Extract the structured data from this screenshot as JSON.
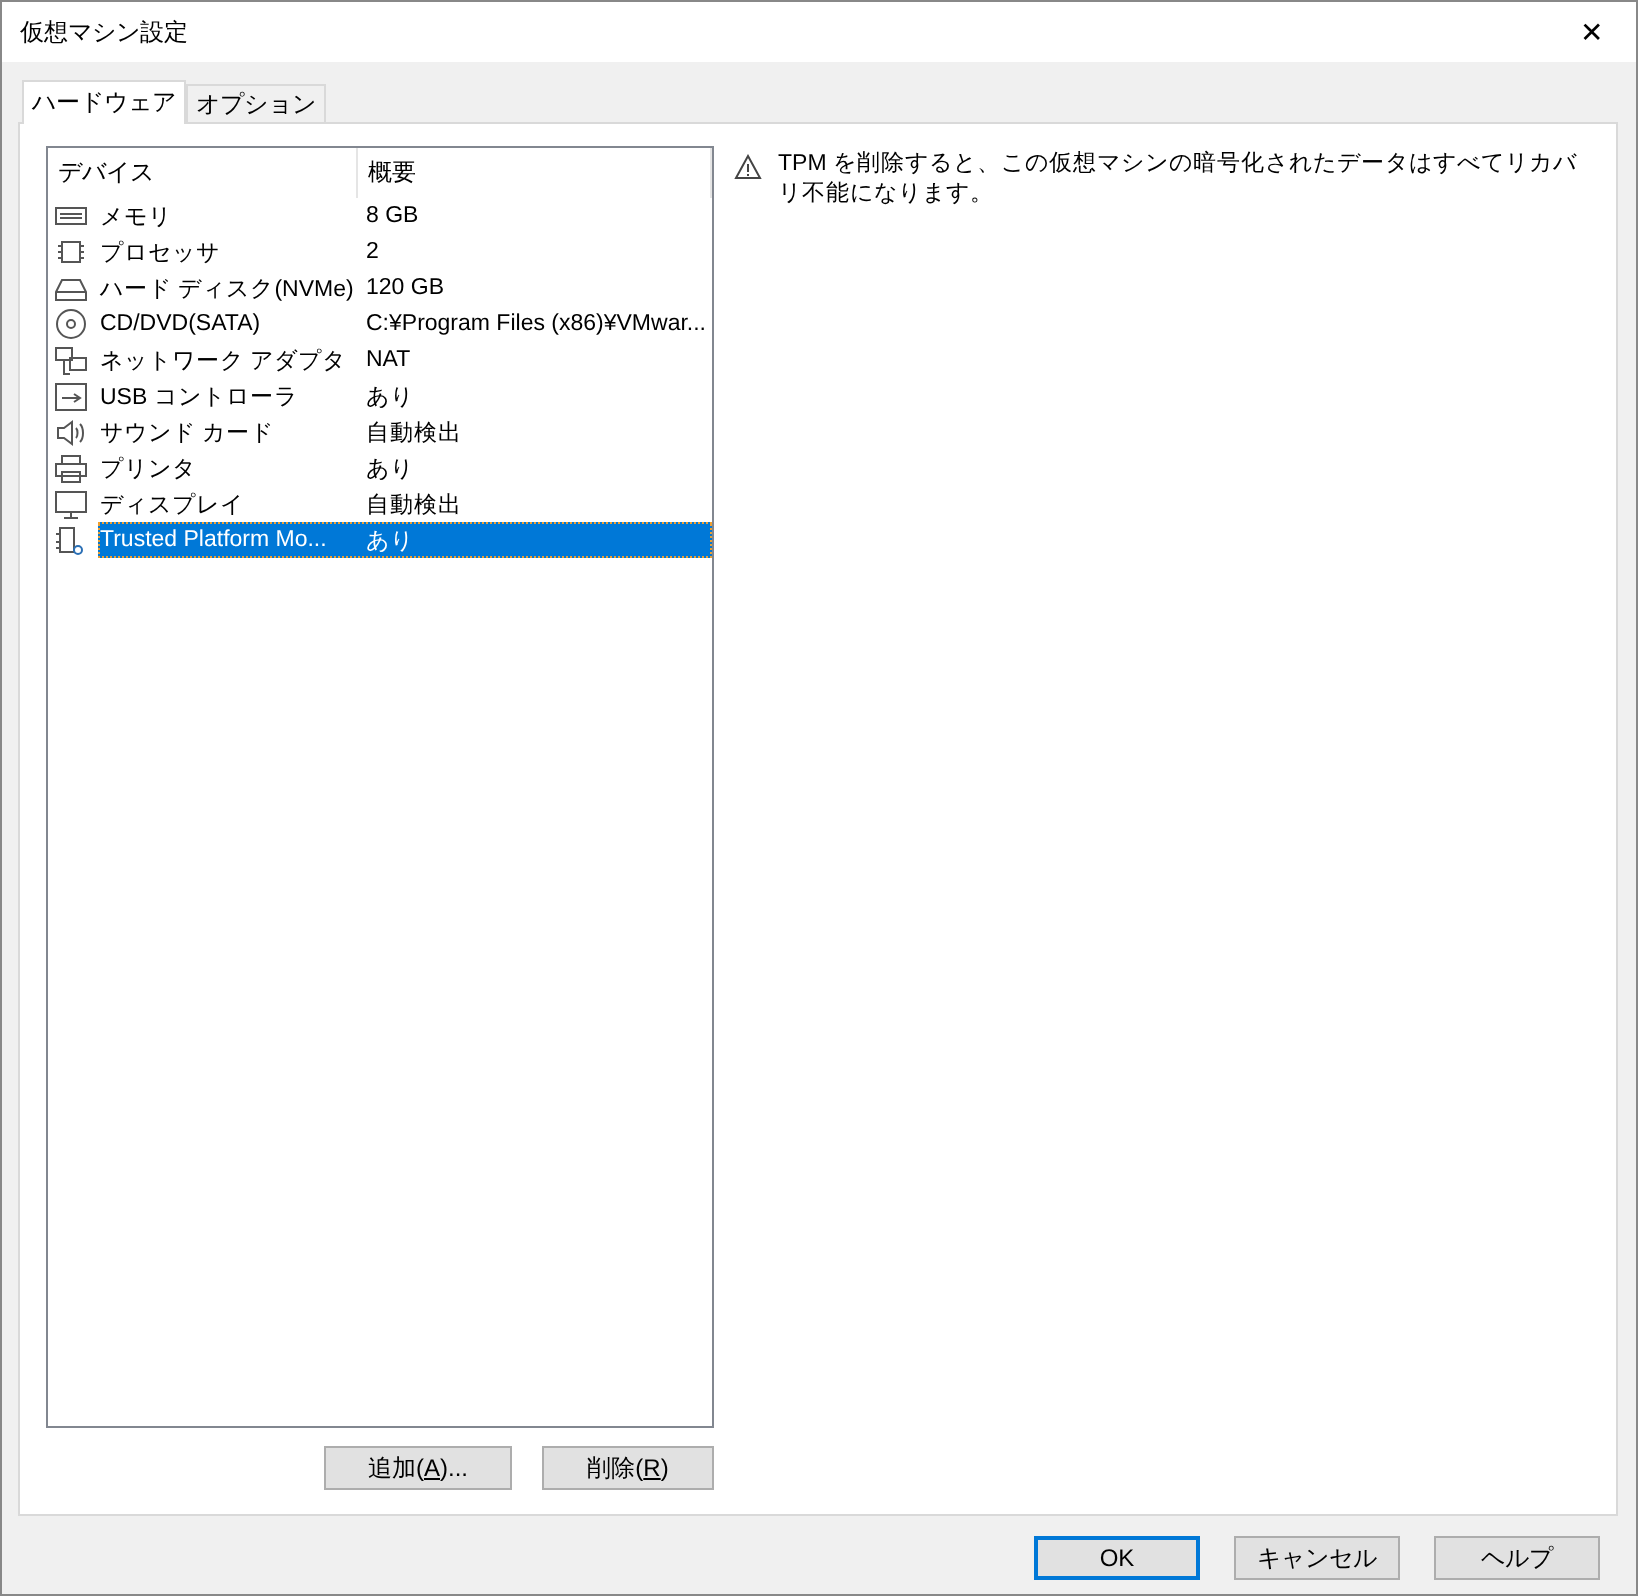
{
  "window": {
    "title": "仮想マシン設定",
    "close": "✕"
  },
  "tabs": [
    {
      "label": "ハードウェア",
      "selected": true
    },
    {
      "label": "オプション",
      "selected": false
    }
  ],
  "device_list": {
    "columns": [
      "デバイス",
      "概要"
    ],
    "rows": [
      {
        "kind": "memory",
        "name": "メモリ",
        "summary": "8 GB",
        "selected": false
      },
      {
        "kind": "cpu",
        "name": "プロセッサ",
        "summary": "2",
        "selected": false
      },
      {
        "kind": "disk",
        "name": "ハード ディスク(NVMe)",
        "summary": "120 GB",
        "selected": false
      },
      {
        "kind": "cd",
        "name": "CD/DVD(SATA)",
        "summary": "C:¥Program Files (x86)¥VMwar...",
        "selected": false
      },
      {
        "kind": "network",
        "name": "ネットワーク アダプタ",
        "summary": "NAT",
        "selected": false
      },
      {
        "kind": "usb",
        "name": "USB コントローラ",
        "summary": "あり",
        "selected": false
      },
      {
        "kind": "sound",
        "name": "サウンド カード",
        "summary": "自動検出",
        "selected": false
      },
      {
        "kind": "printer",
        "name": "プリンタ",
        "summary": "あり",
        "selected": false
      },
      {
        "kind": "display",
        "name": "ディスプレイ",
        "summary": "自動検出",
        "selected": false
      },
      {
        "kind": "tpm",
        "name": "Trusted Platform Mo...",
        "summary": "あり",
        "selected": true
      }
    ]
  },
  "list_buttons": [
    {
      "parts": [
        "追加(",
        "A",
        ")..."
      ]
    },
    {
      "parts": [
        "削除(",
        "R",
        ")"
      ]
    }
  ],
  "warning": "TPM を削除すると、この仮想マシンの暗号化されたデータはすべてリカバリ不能になります。",
  "dialog_buttons": [
    {
      "label": "OK",
      "default": true
    },
    {
      "label": "キャンセル",
      "default": false
    },
    {
      "label": "ヘルプ",
      "default": false
    }
  ]
}
